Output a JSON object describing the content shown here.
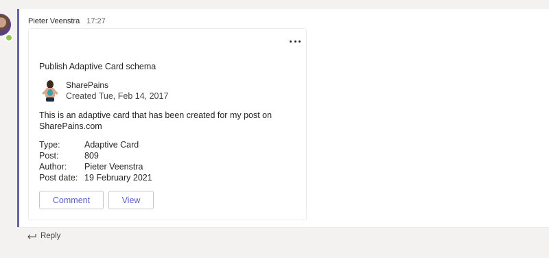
{
  "message": {
    "sender": "Pieter Veenstra",
    "time": "17:27"
  },
  "card": {
    "title": "Publish Adaptive Card schema",
    "author": {
      "name": "SharePains",
      "created": "Created Tue, Feb 14, 2017"
    },
    "description": "This is an adaptive card that has been created for my post on SharePains.com",
    "facts": [
      {
        "key": "Type:",
        "value": "Adaptive Card"
      },
      {
        "key": "Post:",
        "value": "809"
      },
      {
        "key": "Author:",
        "value": "Pieter Veenstra"
      },
      {
        "key": "Post date:",
        "value": "19 February 2021"
      }
    ],
    "actions": {
      "comment": "Comment",
      "view": "View"
    }
  },
  "reply": {
    "label": "Reply"
  },
  "colors": {
    "accent": "#6264a7",
    "button_text": "#5b5fc7",
    "presence": "#92c353"
  },
  "icons": [
    "avatar",
    "presence-available-icon",
    "more-options-icon",
    "author-image",
    "reply-arrow-icon"
  ]
}
